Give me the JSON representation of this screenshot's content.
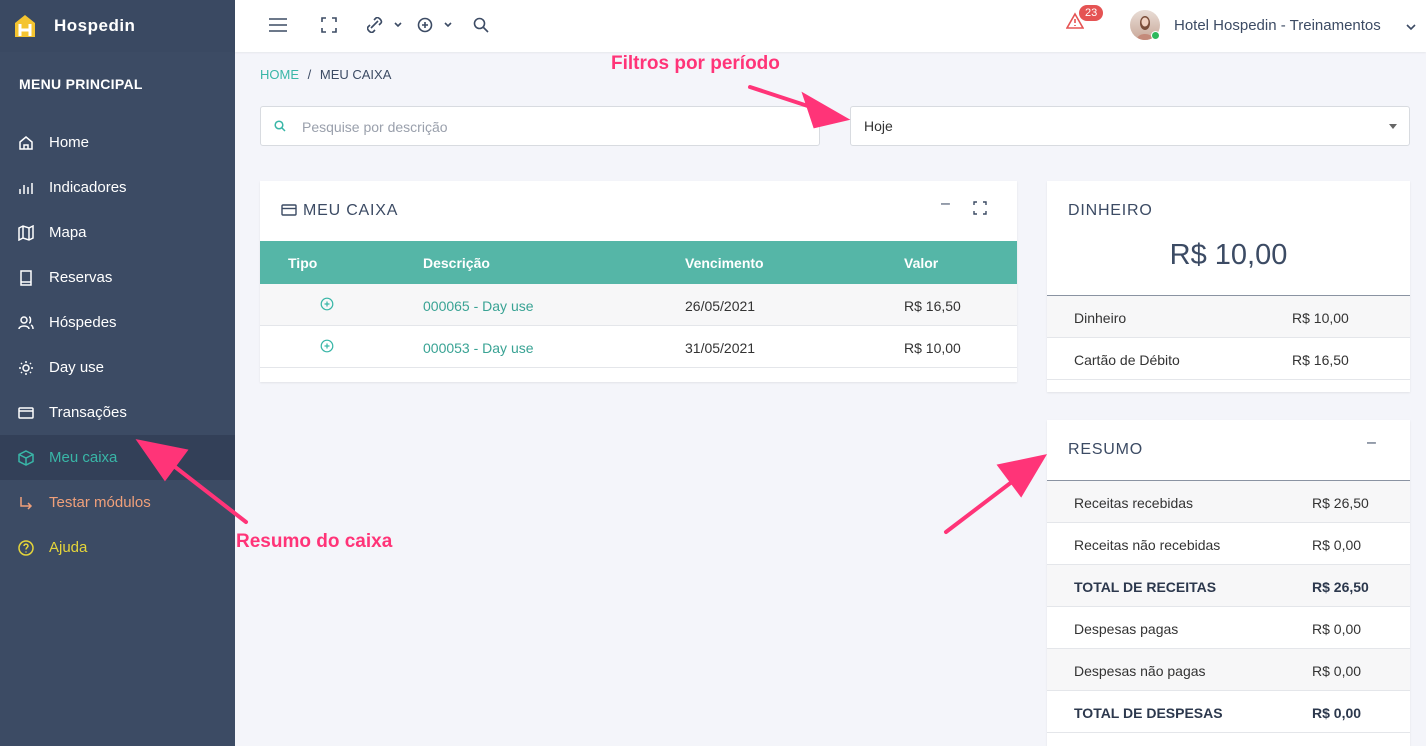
{
  "brand": {
    "name": "Hospedin",
    "logo_letter": "H"
  },
  "menu": {
    "title": "MENU PRINCIPAL",
    "items": [
      {
        "label": "Home",
        "icon": "home-icon"
      },
      {
        "label": "Indicadores",
        "icon": "chart-icon"
      },
      {
        "label": "Mapa",
        "icon": "map-icon"
      },
      {
        "label": "Reservas",
        "icon": "book-icon"
      },
      {
        "label": "Hóspedes",
        "icon": "users-icon"
      },
      {
        "label": "Day use",
        "icon": "sun-icon"
      },
      {
        "label": "Transações",
        "icon": "card-icon"
      },
      {
        "label": "Meu caixa",
        "icon": "cube-icon",
        "active": true
      },
      {
        "label": "Testar módulos",
        "icon": "arrow-icon"
      },
      {
        "label": "Ajuda",
        "icon": "help-icon"
      }
    ]
  },
  "topbar": {
    "alert_count": "23",
    "hotel_name": "Hotel Hospedin - Treinamentos"
  },
  "breadcrumb": {
    "home": "HOME",
    "separator": "/",
    "current": "MEU CAIXA"
  },
  "search": {
    "placeholder": "Pesquise por descrição"
  },
  "period_filter": {
    "selected": "Hoje"
  },
  "meu_caixa": {
    "title": "MEU CAIXA",
    "columns": [
      "Tipo",
      "Descrição",
      "Vencimento",
      "Valor"
    ],
    "rows": [
      {
        "descricao": "000065 - Day use",
        "vencimento": "26/05/2021",
        "valor": "R$ 16,50"
      },
      {
        "descricao": "000053 - Day use",
        "vencimento": "31/05/2021",
        "valor": "R$ 10,00"
      }
    ]
  },
  "dinheiro": {
    "title": "DINHEIRO",
    "total": "R$ 10,00",
    "rows": [
      {
        "label": "Dinheiro",
        "value": "R$ 10,00"
      },
      {
        "label": "Cartão de Débito",
        "value": "R$ 16,50"
      }
    ]
  },
  "resumo": {
    "title": "RESUMO",
    "rows": [
      {
        "label": "Receitas recebidas",
        "value": "R$ 26,50"
      },
      {
        "label": "Receitas não recebidas",
        "value": "R$ 0,00"
      },
      {
        "label": "TOTAL DE RECEITAS",
        "value": "R$ 26,50"
      },
      {
        "label": "Despesas pagas",
        "value": "R$ 0,00"
      },
      {
        "label": "Despesas não pagas",
        "value": "R$ 0,00"
      },
      {
        "label": "TOTAL DE DESPESAS",
        "value": "R$ 0,00"
      }
    ]
  },
  "annotations": {
    "filtros": "Filtros por período",
    "resumo_caixa": "Resumo do caixa"
  },
  "colors": {
    "accent": "#55b6a7",
    "sidebar": "#3c4b64",
    "annotation": "#ff3478"
  }
}
